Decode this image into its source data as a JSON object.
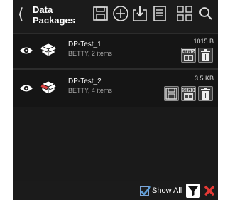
{
  "header": {
    "back_icon": "chevron-left-icon",
    "title": "Data Packages",
    "icons": [
      "save-icon",
      "add-icon",
      "import-icon",
      "document-icon",
      "grid-icon",
      "search-icon"
    ]
  },
  "packages": [
    {
      "name": "DP-Test_1",
      "details": "BETTY, 2 items",
      "size": "1015 B",
      "actions": [
        "send-icon",
        "trash-icon"
      ]
    },
    {
      "name": "DP-Test_2",
      "details": "BETTY, 4 items",
      "size": "3.5 KB",
      "actions": [
        "save-icon",
        "send-icon",
        "trash-icon"
      ]
    }
  ],
  "footer": {
    "show_all_label": "Show All",
    "show_all_checked": true,
    "filter_icon": "filter-icon",
    "close_icon": "close-icon"
  },
  "colors": {
    "background": "#111111",
    "accent_check": "#5b9bd5",
    "close_red": "#e53935",
    "modified_icon_red": "#d94040"
  }
}
